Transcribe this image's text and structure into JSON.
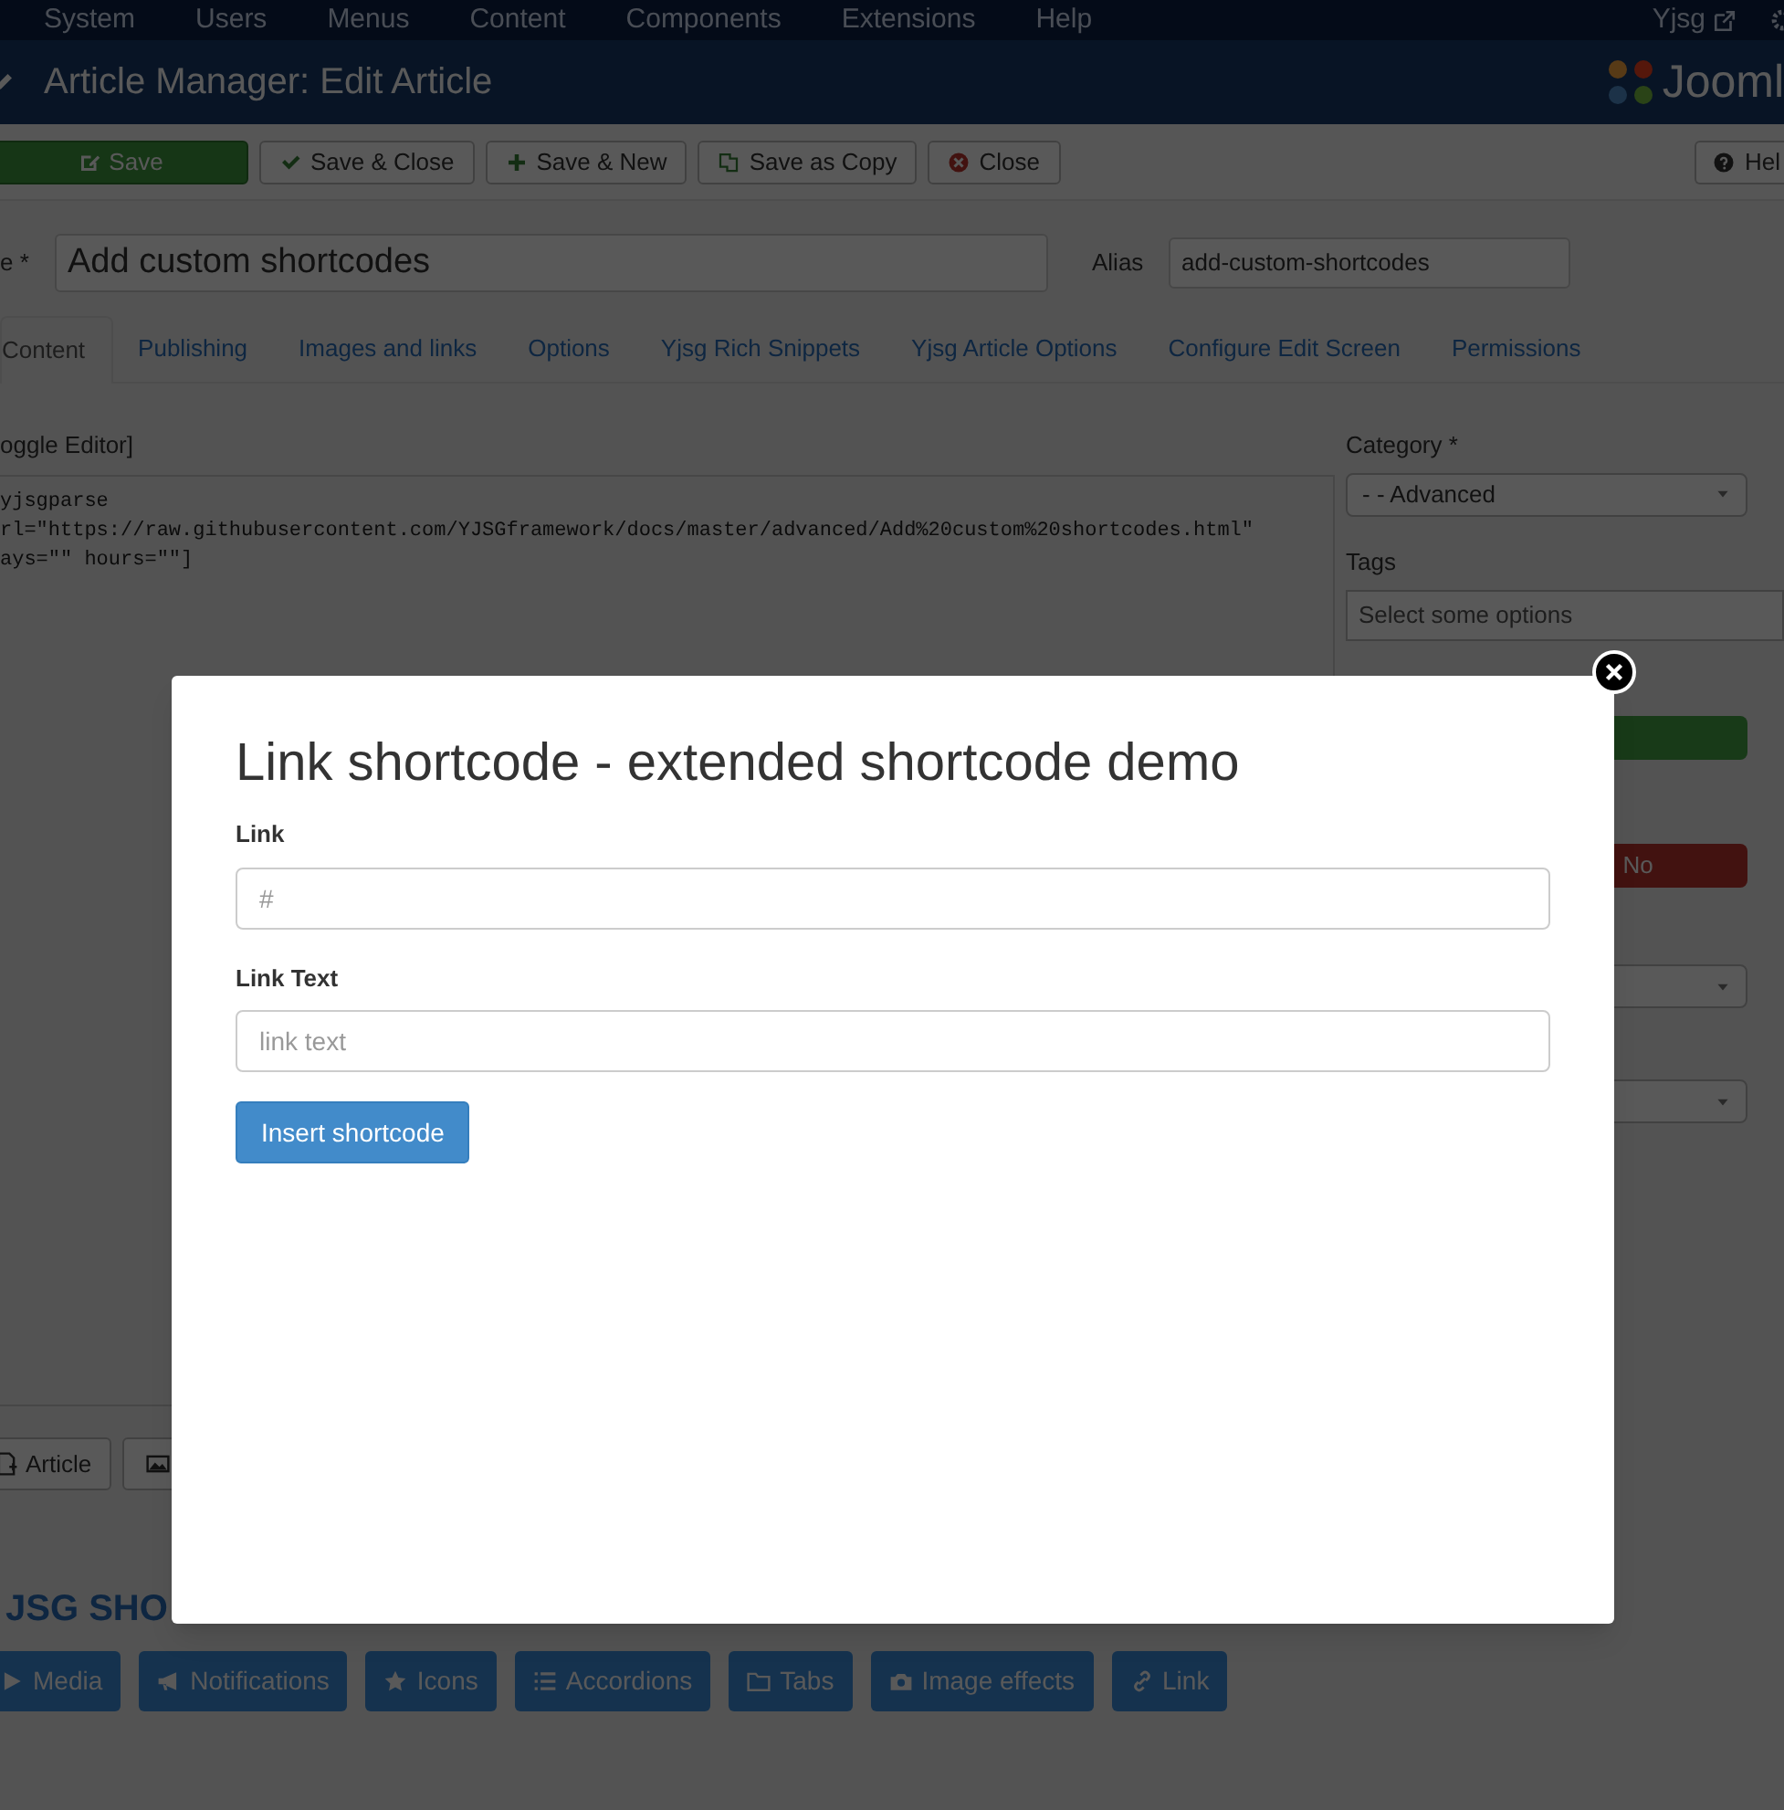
{
  "top_menu": {
    "items": [
      "System",
      "Users",
      "Menus",
      "Content",
      "Components",
      "Extensions",
      "Help"
    ],
    "user": "Yjsg"
  },
  "header": {
    "title": "Article Manager: Edit Article",
    "logo_text": "Jooml"
  },
  "toolbar": {
    "buttons": [
      {
        "label": "Save",
        "kind": "save"
      },
      {
        "label": "Save & Close",
        "kind": "check"
      },
      {
        "label": "Save & New",
        "kind": "plus"
      },
      {
        "label": "Save as Copy",
        "kind": "copy"
      },
      {
        "label": "Close",
        "kind": "close"
      }
    ],
    "help": "Hel"
  },
  "title_field": {
    "label": "e *",
    "value": "Add custom shortcodes"
  },
  "alias_field": {
    "label": "Alias",
    "value": "add-custom-shortcodes"
  },
  "tabs": [
    {
      "label": "Content",
      "selected": true
    },
    {
      "label": "Publishing",
      "selected": false
    },
    {
      "label": "Images and links",
      "selected": false
    },
    {
      "label": "Options",
      "selected": false
    },
    {
      "label": "Yjsg Rich Snippets",
      "selected": false
    },
    {
      "label": "Yjsg Article Options",
      "selected": false
    },
    {
      "label": "Configure Edit Screen",
      "selected": false
    },
    {
      "label": "Permissions",
      "selected": false
    }
  ],
  "editor": {
    "toggle": "oggle Editor]",
    "lines": [
      "yjsgparse",
      "rl=\"https://raw.githubusercontent.com/YJSGframework/docs/master/advanced/Add%20custom%20shortcodes.html\"",
      "ays=\"\" hours=\"\"]"
    ]
  },
  "sidebar": {
    "category": {
      "label": "Category *",
      "value": "- - Advanced"
    },
    "tags": {
      "label": "Tags",
      "placeholder": "Select some options"
    },
    "featured": [
      {
        "label": "No",
        "selected": true
      }
    ]
  },
  "editor_buttons": [
    {
      "label": "Article",
      "kind": "article"
    },
    {
      "kind": "image"
    }
  ],
  "shortcodes": {
    "heading": "JSG SHO",
    "buttons": [
      {
        "label": "Media",
        "kind": "play"
      },
      {
        "label": "Notifications",
        "kind": "bullhorn"
      },
      {
        "label": "Icons",
        "kind": "star"
      },
      {
        "label": "Accordions",
        "kind": "list"
      },
      {
        "label": "Tabs",
        "kind": "folder"
      },
      {
        "label": "Image effects",
        "kind": "camera"
      },
      {
        "label": "Link",
        "kind": "link"
      }
    ]
  },
  "modal": {
    "title": "Link shortcode - extended shortcode demo",
    "fields": [
      {
        "label": "Link",
        "placeholder": "#"
      },
      {
        "label": "Link Text",
        "placeholder": "link text"
      }
    ],
    "button": "Insert shortcode"
  }
}
